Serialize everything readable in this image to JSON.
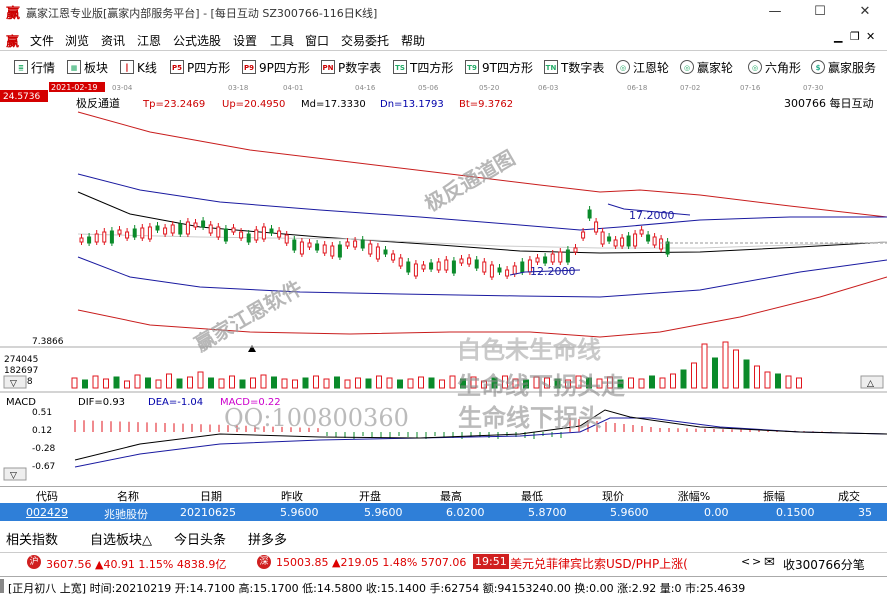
{
  "window": {
    "title": "赢家江恩专业版[赢家内部服务平台] - [每日互动  SZ300766-116日K线]",
    "min": "—",
    "max": "☐",
    "close": "✕"
  },
  "menu": [
    "文件",
    "浏览",
    "资讯",
    "江恩",
    "公式选股",
    "设置",
    "工具",
    "窗口",
    "交易委托",
    "帮助"
  ],
  "toolbar": [
    {
      "icon": "≣",
      "label": "行情"
    },
    {
      "icon": "▦",
      "label": "板块"
    },
    {
      "icon": "┃",
      "label": "K线"
    },
    {
      "icon": "P5",
      "label": "P四方形"
    },
    {
      "icon": "P9",
      "label": "9P四方形"
    },
    {
      "icon": "PN",
      "label": "P数字表"
    },
    {
      "icon": "TS",
      "label": "T四方形"
    },
    {
      "icon": "T9",
      "label": "9T四方形"
    },
    {
      "icon": "TN",
      "label": "T数字表"
    },
    {
      "icon": "◎",
      "label": "江恩轮"
    },
    {
      "icon": "◎",
      "label": "赢家轮"
    },
    {
      "icon": "◎",
      "label": "六角形"
    },
    {
      "icon": "$",
      "label": "赢家服务"
    }
  ],
  "chart": {
    "price_tag": "24.5736",
    "date_tag": "2021-02-19",
    "time_ticks": [
      "03-04",
      "03-18",
      "04-01",
      "04-16",
      "05-06",
      "05-20",
      "06-03",
      "06-18",
      "07-02",
      "07-16",
      "07-30"
    ],
    "indicator_name": "极反通道",
    "params": {
      "tp": "Tp=23.2469",
      "up": "Up=20.4950",
      "md": "Md=17.3330",
      "dn": "Dn=13.1793",
      "bt": "Bt=9.3762"
    },
    "stock_info": "300766  每日互动",
    "annot_high": "17.2000",
    "annot_low": "12.2000",
    "low_price": "7.3866",
    "vol_ticks": [
      "274045",
      "182697",
      "91348"
    ],
    "watermark_diag1": "极反通道图",
    "watermark_diag2": "赢家江恩软件",
    "watermark_l1": "白色未生命线",
    "watermark_l2": "生命线下拐头",
    "watermark_l3": "生命线下拐头走",
    "watermark_qq": "QQ:100800360",
    "macd": {
      "label": "MACD",
      "dif": "DIF=0.93",
      "dea": "DEA=-1.04",
      "macd": "MACD=0.22",
      "ticks": [
        "0.51",
        "0.12",
        "-0.28",
        "-0.67"
      ]
    },
    "colors": {
      "up": "#e0161e",
      "down": "#0a8a2a",
      "channel_outer": "#c81d1d",
      "channel_inner": "#1a1aa0",
      "mid": "#000000"
    }
  },
  "table": {
    "headers": [
      "代码",
      "名称",
      "日期",
      "昨收",
      "开盘",
      "最高",
      "最低",
      "现价",
      "涨幅%",
      "振幅",
      "成交"
    ],
    "row": [
      "002429",
      "兆驰股份",
      "20210625",
      "5.9600",
      "5.9600",
      "6.0200",
      "5.8700",
      "5.9600",
      "0.00",
      "0.1500",
      "35"
    ]
  },
  "tabs": [
    "相关指数",
    "自选板块△",
    "今日头条",
    "拼多多"
  ],
  "status1": {
    "sh_icon": "沪",
    "sh": "3607.56 ▲40.91 1.15% 4838.9亿",
    "sz_icon": "深",
    "sz": "15003.85 ▲219.05 1.48% 5707.06",
    "time": "19:51",
    "news": "美元兑菲律宾比索USD/PHP上涨(",
    "right": "收300766分笔"
  },
  "status2": "[正月初八 上宽] 时间:20210219 开:14.7100 高:15.1700 低:14.5800 收:15.1400 手:62754 额:94153240.00 换:0.00 涨:2.92 量:0 市:25.4639"
}
